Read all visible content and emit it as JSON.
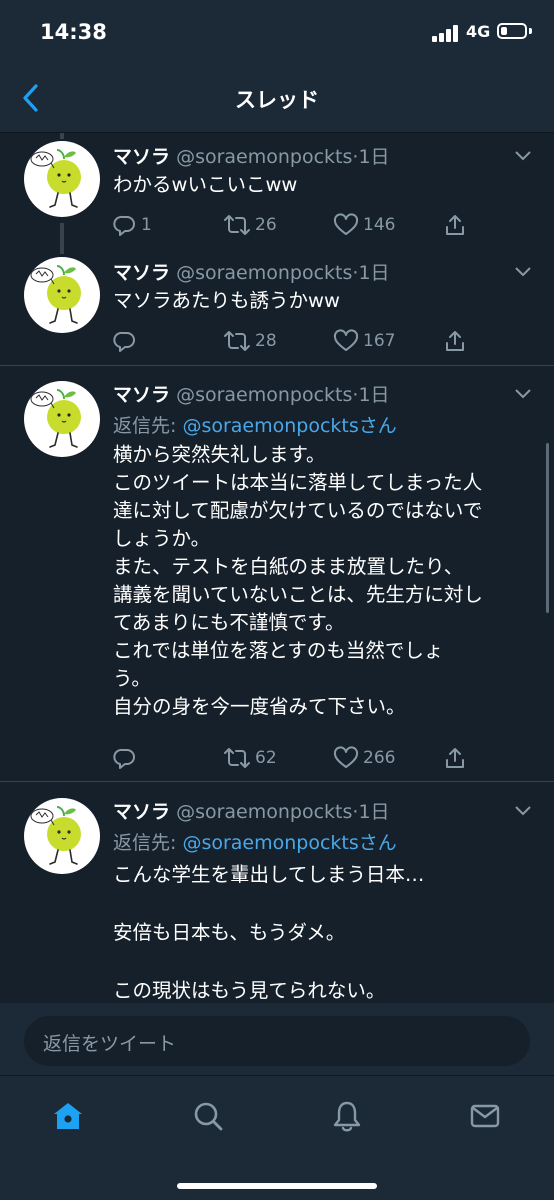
{
  "status_bar": {
    "time": "14:38",
    "network": "4G"
  },
  "nav": {
    "title": "スレッド",
    "back_icon": "chevron-left-icon"
  },
  "colors": {
    "background": "#15202b",
    "bar": "#1c2a38",
    "accent": "#1da1f2",
    "mention": "#4aa7e8",
    "secondary_text": "#8899a6",
    "divider": "#38444d"
  },
  "tweets": [
    {
      "name": "マソラ",
      "handle": "@soraemonpockts",
      "dot": "·",
      "time": "1日",
      "text": "わかるwいこいこww",
      "replies": "1",
      "retweets": "26",
      "likes": "146"
    },
    {
      "name": "マソラ",
      "handle": "@soraemonpockts",
      "dot": "·",
      "time": "1日",
      "text": "マソラあたりも誘うかww",
      "replies": "",
      "retweets": "28",
      "likes": "167"
    },
    {
      "name": "マソラ",
      "handle": "@soraemonpockts",
      "dot": "·",
      "time": "1日",
      "reply_prefix": "返信先: ",
      "reply_mention": "@soraemonpockts",
      "reply_suffix": "さん",
      "lines": [
        "横から突然失礼します。",
        "このツイートは本当に落単してしまった人",
        "達に対して配慮が欠けているのではないで",
        "しょうか。",
        "また、テストを白紙のまま放置したり、",
        "講義を聞いていないことは、先生方に対し",
        "てあまりにも不謹慎です。",
        "これでは単位を落とすのも当然でしょ",
        "う。",
        "自分の身を今一度省みて下さい。"
      ],
      "replies": "",
      "retweets": "62",
      "likes": "266"
    },
    {
      "name": "マソラ",
      "handle": "@soraemonpockts",
      "dot": "·",
      "time": "1日",
      "reply_prefix": "返信先: ",
      "reply_mention": "@soraemonpockts",
      "reply_suffix": "さん",
      "lines": [
        "こんな学生を輩出してしまう日本…",
        "",
        "安倍も日本も、もうダメ。",
        "",
        "この現状はもう見てられない。"
      ]
    }
  ],
  "compose": {
    "placeholder": "返信をツイート"
  },
  "tab_bar": {
    "items": [
      "home-icon",
      "search-icon",
      "notifications-icon",
      "messages-icon"
    ]
  }
}
